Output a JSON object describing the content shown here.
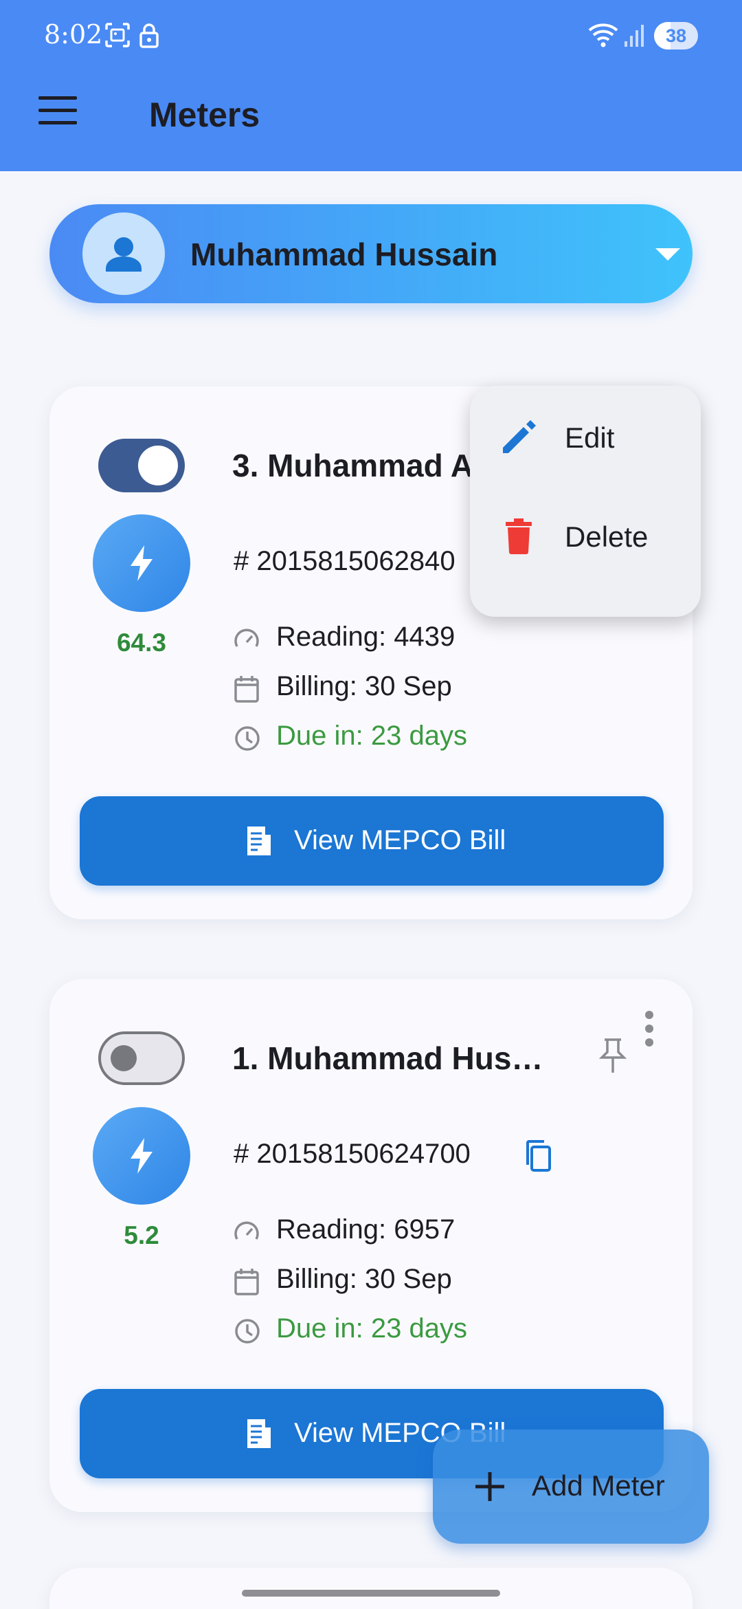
{
  "status_bar": {
    "time": "8:02",
    "battery": "38",
    "battery_level": 0.38,
    "icons": [
      "screenshot-icon",
      "lock-icon",
      "wifi-icon",
      "signal-icon"
    ]
  },
  "app_bar": {
    "title": "Meters",
    "menu_icon": "menu-icon",
    "color": "#4a8af4"
  },
  "user_selector": {
    "name": "Muhammad Hussain",
    "icon": "person-icon",
    "dropdown_icon": "caret-down-icon"
  },
  "meters": [
    {
      "title": "3. Muhammad A",
      "number": "# 2015815062840",
      "enabled": true,
      "usage": "64.3",
      "reading": "Reading: 4439",
      "billing": "Billing: 30 Sep",
      "due": "Due in: 23 days",
      "button_label": "View MEPCO Bill"
    },
    {
      "title": "1. Muhammad Hus…",
      "number": "# 20158150624700",
      "enabled": false,
      "usage": "5.2",
      "reading": "Reading: 6957",
      "billing": "Billing: 30 Sep",
      "due": "Due in: 23 days",
      "button_label": "View MEPCO Bill"
    }
  ],
  "context_menu": {
    "items": [
      {
        "label": "Edit",
        "icon": "pencil-icon",
        "color": "#1b76d4"
      },
      {
        "label": "Delete",
        "icon": "trash-icon",
        "color": "#ef3b35"
      }
    ]
  },
  "fab": {
    "label": "Add Meter",
    "icon": "plus-icon"
  },
  "colors": {
    "accent": "#1b76d4",
    "due_green": "#3b9a40",
    "usage_green": "#2e8b3a"
  }
}
